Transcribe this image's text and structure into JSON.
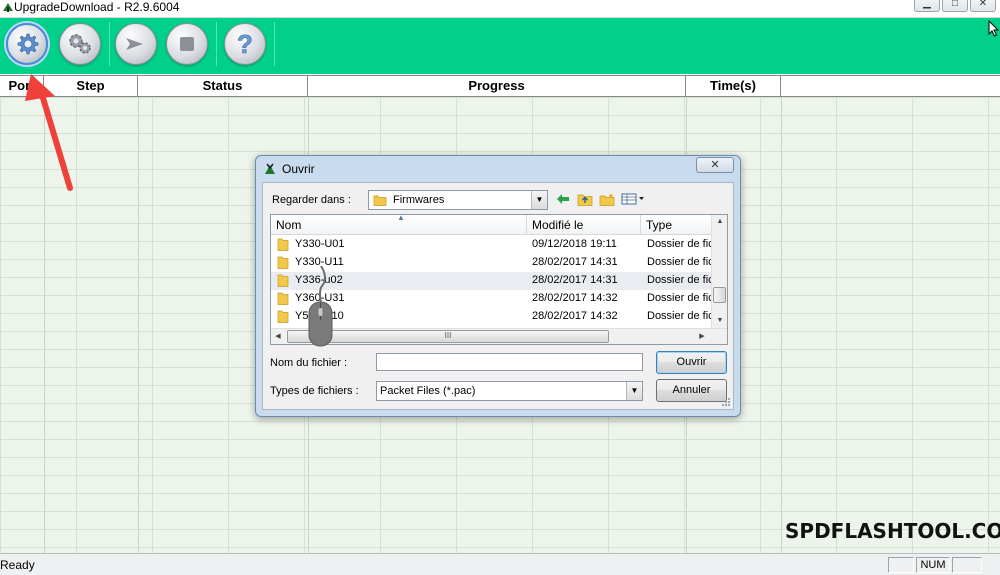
{
  "window": {
    "title": "UpgradeDownload - R2.9.6004"
  },
  "toolbar": {
    "buttons": [
      {
        "icon": "gear-icon",
        "label": "load-packet"
      },
      {
        "icon": "gears-icon",
        "label": "settings"
      },
      {
        "icon": "play-icon",
        "label": "start"
      },
      {
        "icon": "stop-icon",
        "label": "stop"
      },
      {
        "icon": "help-icon",
        "label": "help"
      }
    ]
  },
  "grid": {
    "columns": [
      "Port",
      "Step",
      "Status",
      "Progress",
      "Time(s)"
    ]
  },
  "status_bar": {
    "text": "Ready",
    "num": "NUM"
  },
  "watermark": "SPDFLASHTOOL.COM",
  "dialog": {
    "title": "Ouvrir",
    "look_in_label": "Regarder dans :",
    "look_in_value": "Firmwares",
    "columns": [
      "Nom",
      "Modifié le",
      "Type"
    ],
    "files": [
      {
        "name": "Y330-U01",
        "modified": "09/12/2018 19:11",
        "type": "Dossier de fic"
      },
      {
        "name": "Y330-U11",
        "modified": "28/02/2017 14:31",
        "type": "Dossier de fic"
      },
      {
        "name": "Y336-u02",
        "modified": "28/02/2017 14:31",
        "type": "Dossier de fic"
      },
      {
        "name": "Y360-U31",
        "modified": "28/02/2017 14:32",
        "type": "Dossier de fic"
      },
      {
        "name": "Y511-U10",
        "modified": "28/02/2017 14:32",
        "type": "Dossier de fic"
      }
    ],
    "filename_label": "Nom du fichier :",
    "filename_value": "",
    "filetype_label": "Types de fichiers :",
    "filetype_value": "Packet Files (*.pac)",
    "open_button": "Ouvrir",
    "cancel_button": "Annuler",
    "hscroll_grip": "III"
  },
  "colors": {
    "toolbar_bg": "#00d089",
    "grid_bg": "#edf4ec",
    "arrow": "#f0403a"
  }
}
